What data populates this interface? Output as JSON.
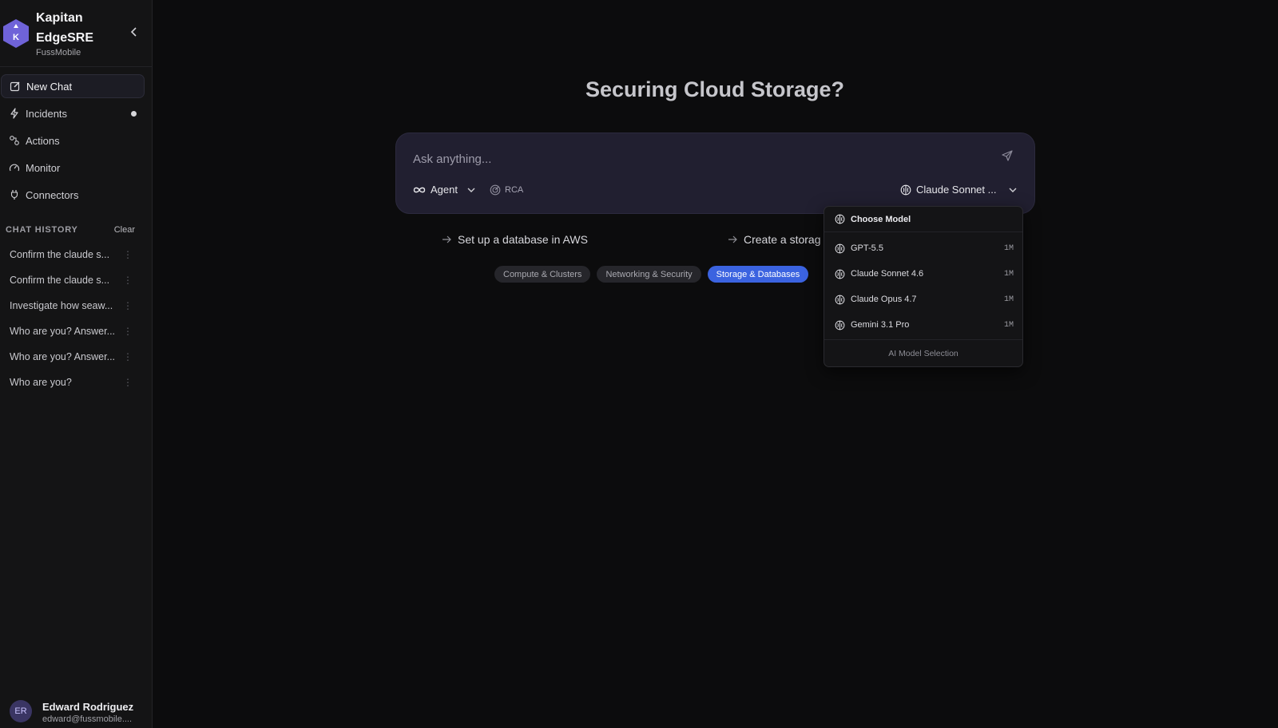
{
  "sidebar": {
    "brand_name": "Kapitan EdgeSRE",
    "brand_logo_letter": "K",
    "org": "FussMobile",
    "nav": [
      {
        "label": "New Chat",
        "icon": "edit-icon"
      },
      {
        "label": "Incidents",
        "icon": "bolt-icon"
      },
      {
        "label": "Actions",
        "icon": "workflow-icon"
      },
      {
        "label": "Monitor",
        "icon": "gauge-icon"
      },
      {
        "label": "Connectors",
        "icon": "plug-icon"
      }
    ],
    "history_title": "CHAT HISTORY",
    "history_clear": "Clear",
    "history": [
      "Confirm the claude s...",
      "Confirm the claude s...",
      "Investigate how seaw...",
      "Who are you? Answer...",
      "Who are you? Answer...",
      "Who are you?"
    ],
    "user": {
      "initials": "ER",
      "name": "Edward Rodriguez",
      "email": "edward@fussmobile...."
    }
  },
  "main": {
    "headline": "Securing Cloud Storage?",
    "composer": {
      "placeholder": "Ask anything...",
      "agent_label": "Agent",
      "rca_label": "RCA",
      "model_label": "Claude Sonnet ..."
    },
    "suggestions": [
      "Set up a database in AWS",
      "Create a storag"
    ],
    "chips": [
      "Compute & Clusters",
      "Networking & Security",
      "Storage & Databases"
    ],
    "active_chip": "Storage & Databases"
  },
  "model_menu": {
    "header": "Choose Model",
    "models": [
      {
        "name": "GPT-5.5",
        "context": "1M"
      },
      {
        "name": "Claude Sonnet 4.6",
        "context": "1M"
      },
      {
        "name": "Claude Opus 4.7",
        "context": "1M"
      },
      {
        "name": "Gemini 3.1 Pro",
        "context": "1M"
      }
    ],
    "footer": "AI Model Selection"
  },
  "colors": {
    "accent": "#3b63e0",
    "logo": "#6f63d8",
    "composer_bg": "#211f30"
  }
}
